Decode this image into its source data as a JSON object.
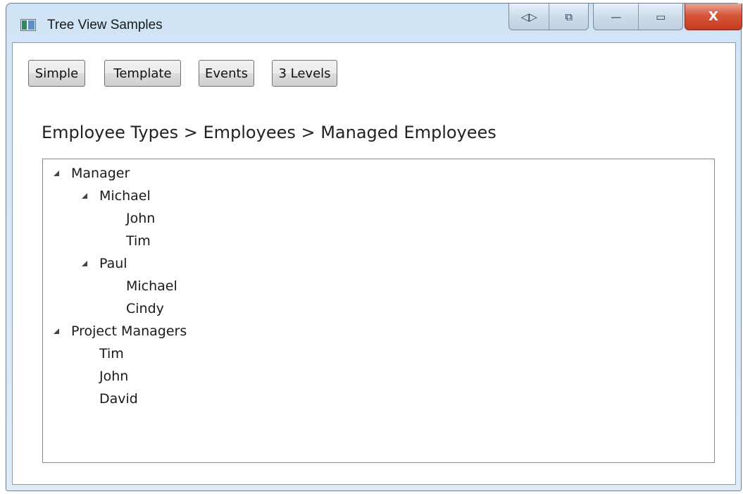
{
  "window": {
    "title": "Tree View Samples",
    "controls": {
      "group1": [
        "◁▷",
        "⧉"
      ],
      "minimize": "—",
      "maximize": "▭",
      "close": "X"
    }
  },
  "toolbar": {
    "buttons": [
      "Simple",
      "Template",
      "Events",
      "3 Levels"
    ]
  },
  "breadcrumb": "Employee Types > Employees > Managed Employees",
  "tree": {
    "nodes": [
      {
        "label": "Manager",
        "expanded": true
      },
      {
        "label": "Michael",
        "expanded": true
      },
      {
        "label": "John"
      },
      {
        "label": "Tim"
      },
      {
        "label": "Paul",
        "expanded": true
      },
      {
        "label": "Michael"
      },
      {
        "label": "Cindy"
      },
      {
        "label": "Project Managers",
        "expanded": true
      },
      {
        "label": "Tim"
      },
      {
        "label": "John"
      },
      {
        "label": "David"
      }
    ]
  },
  "icons": {
    "expander": "expanded-triangle-icon",
    "app": "app-window-icon"
  },
  "colors": {
    "titlebar": "#d6e7f7",
    "close_button": "#c63a1f",
    "tree_border": "#828790"
  }
}
